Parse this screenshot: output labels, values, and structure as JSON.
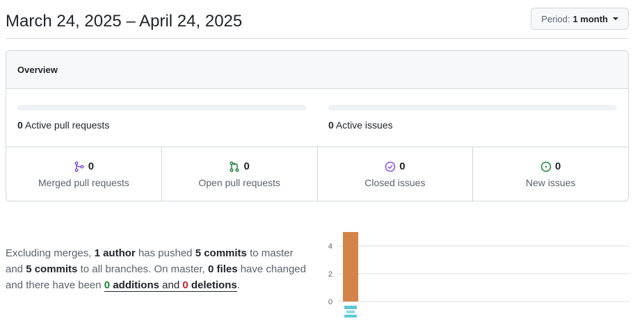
{
  "header": {
    "title": "March 24, 2025 – April 24, 2025",
    "period_prefix": "Period:",
    "period_value": "1 month"
  },
  "overview": {
    "title": "Overview",
    "active_prs": {
      "count": "0",
      "label": "Active pull requests",
      "fill": 0
    },
    "active_issues": {
      "count": "0",
      "label": "Active issues",
      "fill": 0
    },
    "summary": [
      {
        "icon": "git-merge-icon",
        "count": "0",
        "label": "Merged pull requests",
        "color": "#8250df"
      },
      {
        "icon": "git-pull-request-icon",
        "count": "0",
        "label": "Open pull requests",
        "color": "#1a7f37"
      },
      {
        "icon": "issue-closed-icon",
        "count": "0",
        "label": "Closed issues",
        "color": "#8250df"
      },
      {
        "icon": "issue-opened-icon",
        "count": "0",
        "label": "New issues",
        "color": "#1a7f37"
      }
    ]
  },
  "commits": {
    "p1": "Excluding merges,",
    "authors": "1 author",
    "p2": "has pushed",
    "commits_master": "5 commits",
    "p3": "to master and",
    "commits_all": "5 commits",
    "p4": "to all branches. On master,",
    "files": "0 files",
    "p5": "have changed and there have been",
    "additions_count": "0",
    "additions_word": "additions",
    "and_word": "and",
    "deletions_count": "0",
    "deletions_word": "deletions",
    "end": "."
  },
  "chart_data": {
    "type": "bar",
    "categories": [
      ""
    ],
    "values": [
      5
    ],
    "yticks": [
      0,
      2,
      4
    ],
    "ylim": [
      0,
      5
    ],
    "bar_color": "#d4834b",
    "grid": true,
    "title": "",
    "xlabel": "",
    "ylabel": ""
  }
}
